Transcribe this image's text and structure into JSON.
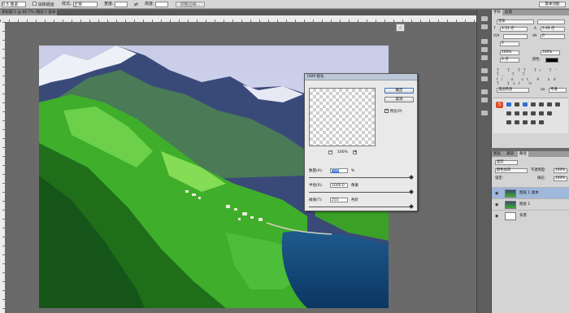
{
  "options_bar": {
    "size_value": "0.5 像素",
    "antialias_label": "消除锯齿",
    "style_label": "样式:",
    "style_value": "正常",
    "width_label": "宽度:",
    "height_label": "高度:",
    "refine_label": "调整边缘...",
    "workspace_value": "基本功能"
  },
  "document_tab": {
    "label": "未标题-1 @ 66.7% (图层 1 副本, RGB/8)"
  },
  "dialog": {
    "title": "USM 锐化",
    "ok_label": "确定",
    "cancel_label": "取消",
    "preview_label": "预览(P)",
    "zoom_value": "100%",
    "zoom_minus": "−",
    "zoom_plus": "+",
    "amount": {
      "label": "数量(A):",
      "value": "500",
      "unit": "%",
      "fraction": 0.997
    },
    "radius": {
      "label": "半径(R):",
      "value": "1000.0",
      "unit": "像素",
      "fraction": 1.0
    },
    "threshold": {
      "label": "阈值(T):",
      "value": "255",
      "unit": "色阶",
      "fraction": 1.0
    }
  },
  "character_panel": {
    "tabs": [
      "字符",
      "段落"
    ],
    "font_family": "黑体",
    "font_size": "3.53 点",
    "leading": "5.40 点",
    "tracking": "0",
    "vertical_scale": "100%",
    "horizontal_scale": "100%",
    "baseline_shift": "0 点",
    "color_label": "颜色:",
    "language": "美国英语",
    "aa_method": "平滑",
    "style_glyphs": "T T TT Tr T' T, T T",
    "opentype_glyphs": "fi σ st A ad T 1st ½"
  },
  "layers_panel": {
    "tabs": [
      "图层",
      "通道",
      "路径"
    ],
    "kind_label": "类型",
    "blend_mode": "颜色加深",
    "opacity_label": "不透明度:",
    "opacity_value": "100%",
    "lock_label": "锁定:",
    "fill_label": "填充:",
    "fill_value": "100%",
    "layers": [
      {
        "name": "图层 1 副本",
        "active": true
      },
      {
        "name": "图层 1",
        "active": false
      },
      {
        "name": "背景",
        "active": false
      }
    ]
  },
  "colors": {
    "accent": "#3875d7",
    "dialog_bg": "#e9e9e9",
    "workspace_bg": "#6a6a6a",
    "selected_layer": "#9fb8dc"
  }
}
